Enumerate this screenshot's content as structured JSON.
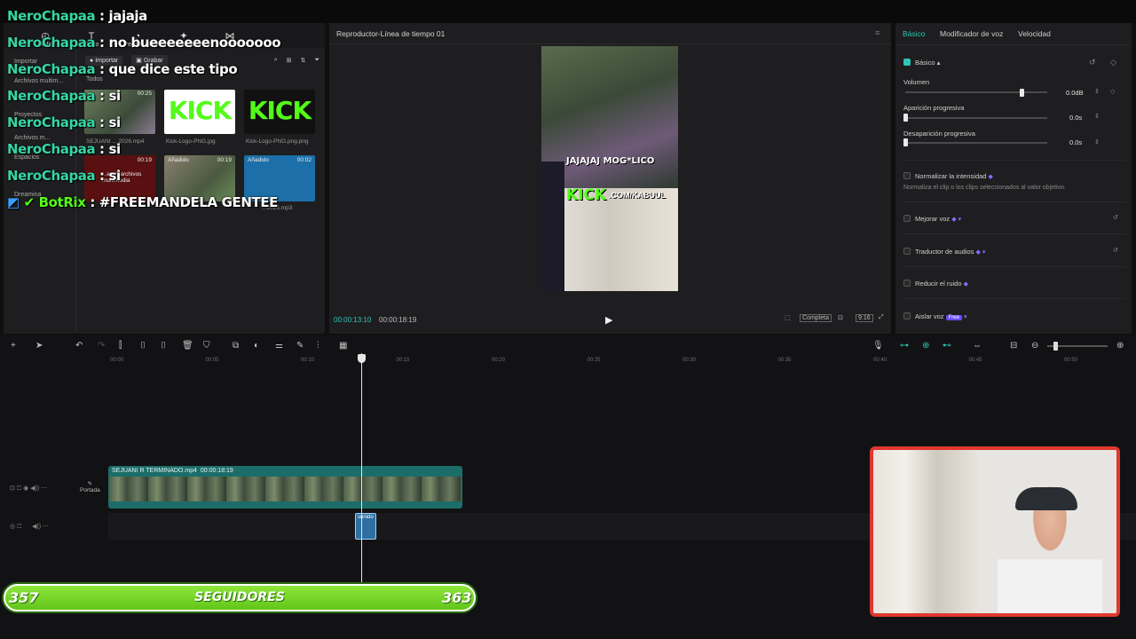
{
  "app": {
    "player_title": "Reproductor-Línea de tiempo 01",
    "accent": "#2fc6b5"
  },
  "left_panel": {
    "tools": [
      "Audio",
      "Texto",
      "Pegatinas",
      "Efectos",
      "Transiciones",
      "Subtítulos",
      "Filtros",
      "Ajust"
    ],
    "side": [
      "Importar",
      "Archivos multim...",
      "Todos",
      "Proyectos",
      "Nube",
      "Archivos m...",
      "Espacios",
      "Dreamina"
    ],
    "import_label": "Importar",
    "record_label": "Grabar",
    "media": [
      {
        "name": "SEJUANI ... 2026.mp4",
        "badge": "00:25"
      },
      {
        "name": "Kick-Logo-PNG.jpg",
        "badge": ""
      },
      {
        "name": "Kick-Logo-PNG.png.png",
        "badge": ""
      },
      {
        "name": "...eron archivos multimedia",
        "badge": "00:19"
      },
      {
        "name": "Añadido",
        "badge": "00:19"
      },
      {
        "name": "...2026.mp3",
        "badge": "00:02",
        "tag": "Añadido"
      }
    ],
    "kick_text": "KICK"
  },
  "chat": [
    {
      "user": "NeroChapaa",
      "msg": "jajaja"
    },
    {
      "user": "NeroChapaa",
      "msg": "no bueeeeeeenooooooo"
    },
    {
      "user": "NeroChapaa",
      "msg": "que dice este tipo"
    },
    {
      "user": "NeroChapaa",
      "msg": "si"
    },
    {
      "user": "NeroChapaa",
      "msg": "si"
    },
    {
      "user": "NeroChapaa",
      "msg": "si"
    },
    {
      "user": "NeroChapaa",
      "msg": "si"
    },
    {
      "user": "BotRix",
      "msg": "#FREEMANDELA GENTEE"
    }
  ],
  "player": {
    "caption": "JAJAJAJ MOG*LICO",
    "kick": "KICK",
    "kick_url": ".COM/KABUUL",
    "time_current": "00:00:13:10",
    "time_total": "00:00:18:19",
    "full_label": "Completa",
    "ratio_label": "9:16"
  },
  "right_panel": {
    "tabs": [
      "Básico",
      "Modificador de voz",
      "Velocidad"
    ],
    "section": "Básico",
    "volume_label": "Volumen",
    "volume_value": "0.0dB",
    "volume_level": 0.82,
    "fade_in_label": "Aparición progresiva",
    "fade_in_value": "0.0s",
    "fade_out_label": "Desaparición progresiva",
    "fade_out_value": "0.0s",
    "normalize_label": "Normalizar la intensidad",
    "normalize_desc": "Normaliza el clip o los clips seleccionados al valor objetivo.",
    "enhance_label": "Mejorar voz",
    "translate_label": "Traductor de audios",
    "noise_label": "Reducir el ruido",
    "isolate_label": "Aislar voz",
    "isolate_badge": "Free"
  },
  "timeline": {
    "ticks": [
      "00:00",
      "00:05",
      "00:10",
      "00:15",
      "00:20",
      "00:25",
      "00:30",
      "00:35",
      "00:40",
      "00:45",
      "00:50"
    ],
    "clip_label": "SEJUANI R TERMINADO.mp4",
    "clip_duration": "00:00:18:19",
    "cover_label": "Portada",
    "sound_label": "sonido"
  },
  "followers": {
    "current": "357",
    "label": "SEGUIDORES",
    "goal": "363"
  }
}
